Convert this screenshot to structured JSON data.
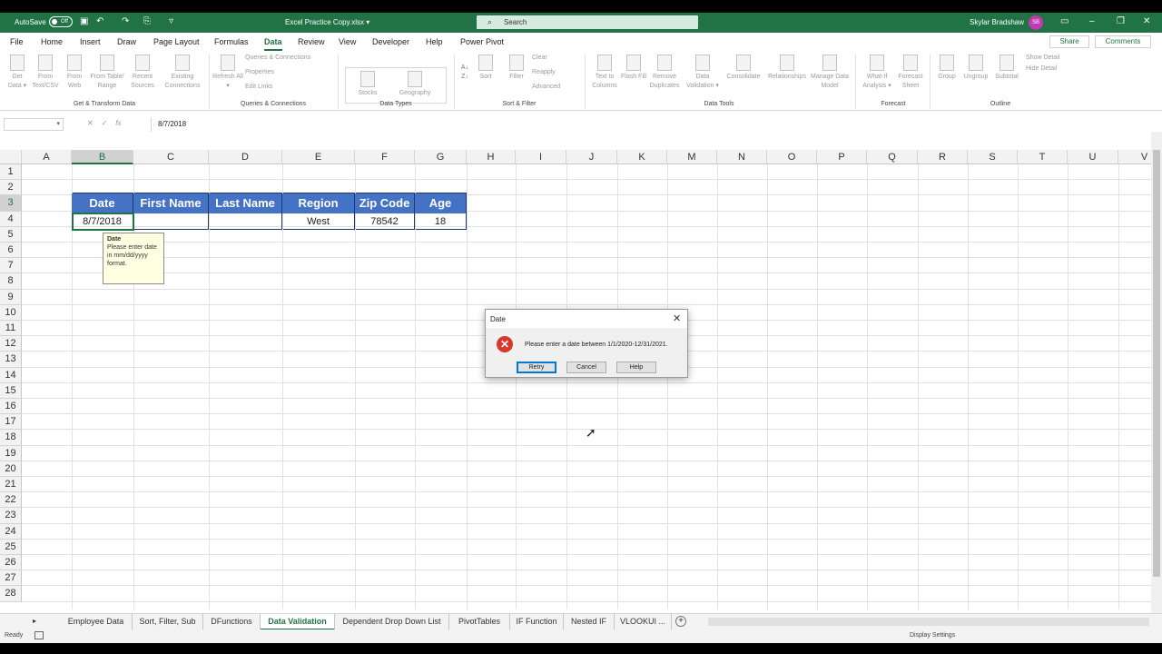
{
  "titlebar": {
    "autosave": "AutoSave",
    "autosave_state": "Off",
    "filename": "Excel Practice Copy.xlsx ▾",
    "search_placeholder": "Search",
    "user": "Skylar Bradshaw",
    "initials": "SB"
  },
  "menu": {
    "tabs": [
      "File",
      "Home",
      "Insert",
      "Draw",
      "Page Layout",
      "Formulas",
      "Data",
      "Review",
      "View",
      "Developer",
      "Help",
      "Power Pivot"
    ],
    "active": "Data",
    "share": "Share",
    "comments": "Comments"
  },
  "ribbon": {
    "get_data": "Get Data ▾",
    "from_text": "From Text/CSV",
    "from_web": "From Web",
    "from_table": "From Table/ Range",
    "recent_sources": "Recent Sources",
    "existing_connections": "Existing Connections",
    "group_get_transform": "Get & Transform Data",
    "refresh_all": "Refresh All ▾",
    "queries_connections": "Queries & Connections",
    "properties": "Properties",
    "edit_links": "Edit Links",
    "group_queries": "Queries & Connections",
    "stocks": "Stocks",
    "geography": "Geography",
    "group_datatypes": "Data Types",
    "sort": "Sort",
    "filter": "Filter",
    "clear": "Clear",
    "reapply": "Reapply",
    "advanced": "Advanced",
    "group_sortfilter": "Sort & Filter",
    "text_to_columns": "Text to Columns",
    "flash_fill": "Flash Fill",
    "remove_duplicates": "Remove Duplicates",
    "data_validation": "Data Validation ▾",
    "consolidate": "Consolidate",
    "relationships": "Relationships",
    "manage_data_model": "Manage Data Model",
    "group_datatools": "Data Tools",
    "what_if": "What-If Analysis ▾",
    "forecast_sheet": "Forecast Sheet",
    "group_forecast": "Forecast",
    "group_btn": "Group",
    "ungroup": "Ungroup",
    "subtotal": "Subtotal",
    "show_detail": "Show Detail",
    "hide_detail": "Hide Detail",
    "group_outline": "Outline"
  },
  "formula_bar": {
    "value": "8/7/2018"
  },
  "grid": {
    "columns": [
      "A",
      "B",
      "C",
      "D",
      "E",
      "F",
      "G",
      "H",
      "I",
      "J",
      "K",
      "M",
      "N",
      "O",
      "P",
      "Q",
      "R",
      "S",
      "T",
      "U",
      "V"
    ],
    "rows": [
      "1",
      "2",
      "3",
      "4",
      "5",
      "6",
      "7",
      "8",
      "9",
      "10",
      "11",
      "12",
      "13",
      "14",
      "15",
      "16",
      "17",
      "18",
      "19",
      "20",
      "21",
      "22",
      "23",
      "24",
      "25",
      "26",
      "27",
      "28"
    ],
    "table_headers": [
      "Date",
      "First Name",
      "Last Name",
      "Region",
      "Zip Code",
      "Age"
    ],
    "table_row": [
      "8/7/2018",
      "",
      "",
      "West",
      "78542",
      "18"
    ],
    "input_message_title": "Date",
    "input_message_body": "Please enter date in mm/dd/yyyy format."
  },
  "dialog": {
    "title": "Date",
    "message": "Please enter a date between 1/1/2020-12/31/2021.",
    "retry": "Retry",
    "cancel": "Cancel",
    "help": "Help"
  },
  "sheets": {
    "tabs": [
      "Employee Data",
      "Sort, Filter, Sub",
      "DFunctions",
      "Data Validation",
      "Dependent Drop Down List",
      "PivotTables",
      "IF Function",
      "Nested IF",
      "VLOOKUI ..."
    ],
    "active": "Data Validation"
  },
  "status": {
    "ready": "Ready",
    "display_settings": "Display Settings"
  },
  "colors": {
    "accent": "#217346",
    "table_header": "#4472c4",
    "error": "#d9372b"
  }
}
